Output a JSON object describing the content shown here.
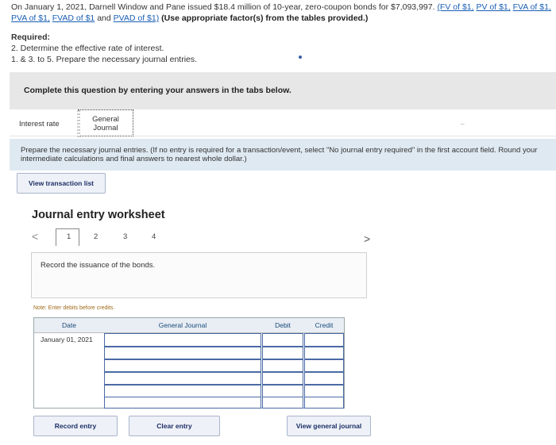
{
  "intro": {
    "text_before": "On January 1, 2021, Darnell Window and Pane issued $18.4 million of 10-year, zero-coupon bonds for $7,093,997.",
    "links": [
      "(FV of $1,",
      "PV of $1,",
      "FVA of $1,",
      "PVA of $1,",
      "FVAD of $1",
      "PVAD of $1)"
    ],
    "connector": "and",
    "instruction": "(Use appropriate factor(s) from the tables provided.)"
  },
  "required": {
    "heading": "Required:",
    "line1": "2. Determine the effective rate of interest.",
    "line2": "1. & 3. to 5. Prepare the necessary journal entries."
  },
  "complete_bar": "Complete this question by entering your answers in the tabs below.",
  "tabs": {
    "interest": "Interest rate",
    "general_line1": "General",
    "general_line2": "Journal"
  },
  "instructions": "Prepare the necessary journal entries. (If no entry is required for a transaction/event, select \"No journal entry required\" in the first account field. Round your intermediate calculations and final answers to nearest whole dollar.)",
  "buttons": {
    "view_transaction": "View transaction list",
    "record_entry": "Record entry",
    "clear_entry": "Clear entry",
    "view_general_journal": "View general journal"
  },
  "worksheet": {
    "title": "Journal entry worksheet",
    "pages": [
      "1",
      "2",
      "3",
      "4"
    ],
    "current_page": "1",
    "prev_symbol": "<",
    "next_symbol": ">",
    "description": "Record the issuance of the bonds.",
    "note": "Note: Enter debits before credits."
  },
  "journal_table": {
    "headers": [
      "Date",
      "General Journal",
      "Debit",
      "Credit"
    ],
    "rows": [
      {
        "date": "January 01, 2021",
        "account": "",
        "debit": "",
        "credit": ""
      },
      {
        "date": "",
        "account": "",
        "debit": "",
        "credit": ""
      },
      {
        "date": "",
        "account": "",
        "debit": "",
        "credit": ""
      },
      {
        "date": "",
        "account": "",
        "debit": "",
        "credit": ""
      },
      {
        "date": "",
        "account": "",
        "debit": "",
        "credit": ""
      },
      {
        "date": "",
        "account": "",
        "debit": "",
        "credit": ""
      }
    ]
  },
  "colors": {
    "link": "#1a5fb4",
    "complete_bar_bg": "#e7e7e7",
    "instructions_bg": "#dfe9f1",
    "button_text": "#1c2f66",
    "input_border": "#4a6aa5"
  }
}
